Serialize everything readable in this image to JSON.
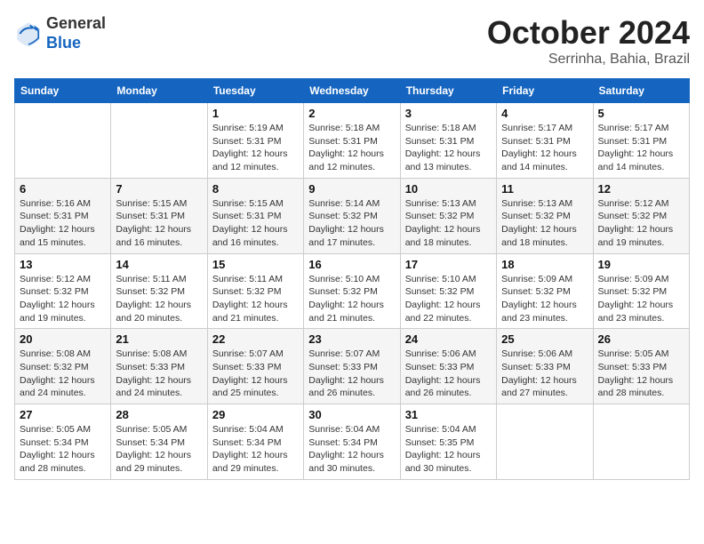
{
  "header": {
    "logo_line1": "General",
    "logo_line2": "Blue",
    "month_year": "October 2024",
    "location": "Serrinha, Bahia, Brazil"
  },
  "weekdays": [
    "Sunday",
    "Monday",
    "Tuesday",
    "Wednesday",
    "Thursday",
    "Friday",
    "Saturday"
  ],
  "weeks": [
    [
      {
        "day": "",
        "sunrise": "",
        "sunset": "",
        "daylight": ""
      },
      {
        "day": "",
        "sunrise": "",
        "sunset": "",
        "daylight": ""
      },
      {
        "day": "1",
        "sunrise": "Sunrise: 5:19 AM",
        "sunset": "Sunset: 5:31 PM",
        "daylight": "Daylight: 12 hours and 12 minutes."
      },
      {
        "day": "2",
        "sunrise": "Sunrise: 5:18 AM",
        "sunset": "Sunset: 5:31 PM",
        "daylight": "Daylight: 12 hours and 12 minutes."
      },
      {
        "day": "3",
        "sunrise": "Sunrise: 5:18 AM",
        "sunset": "Sunset: 5:31 PM",
        "daylight": "Daylight: 12 hours and 13 minutes."
      },
      {
        "day": "4",
        "sunrise": "Sunrise: 5:17 AM",
        "sunset": "Sunset: 5:31 PM",
        "daylight": "Daylight: 12 hours and 14 minutes."
      },
      {
        "day": "5",
        "sunrise": "Sunrise: 5:17 AM",
        "sunset": "Sunset: 5:31 PM",
        "daylight": "Daylight: 12 hours and 14 minutes."
      }
    ],
    [
      {
        "day": "6",
        "sunrise": "Sunrise: 5:16 AM",
        "sunset": "Sunset: 5:31 PM",
        "daylight": "Daylight: 12 hours and 15 minutes."
      },
      {
        "day": "7",
        "sunrise": "Sunrise: 5:15 AM",
        "sunset": "Sunset: 5:31 PM",
        "daylight": "Daylight: 12 hours and 16 minutes."
      },
      {
        "day": "8",
        "sunrise": "Sunrise: 5:15 AM",
        "sunset": "Sunset: 5:31 PM",
        "daylight": "Daylight: 12 hours and 16 minutes."
      },
      {
        "day": "9",
        "sunrise": "Sunrise: 5:14 AM",
        "sunset": "Sunset: 5:32 PM",
        "daylight": "Daylight: 12 hours and 17 minutes."
      },
      {
        "day": "10",
        "sunrise": "Sunrise: 5:13 AM",
        "sunset": "Sunset: 5:32 PM",
        "daylight": "Daylight: 12 hours and 18 minutes."
      },
      {
        "day": "11",
        "sunrise": "Sunrise: 5:13 AM",
        "sunset": "Sunset: 5:32 PM",
        "daylight": "Daylight: 12 hours and 18 minutes."
      },
      {
        "day": "12",
        "sunrise": "Sunrise: 5:12 AM",
        "sunset": "Sunset: 5:32 PM",
        "daylight": "Daylight: 12 hours and 19 minutes."
      }
    ],
    [
      {
        "day": "13",
        "sunrise": "Sunrise: 5:12 AM",
        "sunset": "Sunset: 5:32 PM",
        "daylight": "Daylight: 12 hours and 19 minutes."
      },
      {
        "day": "14",
        "sunrise": "Sunrise: 5:11 AM",
        "sunset": "Sunset: 5:32 PM",
        "daylight": "Daylight: 12 hours and 20 minutes."
      },
      {
        "day": "15",
        "sunrise": "Sunrise: 5:11 AM",
        "sunset": "Sunset: 5:32 PM",
        "daylight": "Daylight: 12 hours and 21 minutes."
      },
      {
        "day": "16",
        "sunrise": "Sunrise: 5:10 AM",
        "sunset": "Sunset: 5:32 PM",
        "daylight": "Daylight: 12 hours and 21 minutes."
      },
      {
        "day": "17",
        "sunrise": "Sunrise: 5:10 AM",
        "sunset": "Sunset: 5:32 PM",
        "daylight": "Daylight: 12 hours and 22 minutes."
      },
      {
        "day": "18",
        "sunrise": "Sunrise: 5:09 AM",
        "sunset": "Sunset: 5:32 PM",
        "daylight": "Daylight: 12 hours and 23 minutes."
      },
      {
        "day": "19",
        "sunrise": "Sunrise: 5:09 AM",
        "sunset": "Sunset: 5:32 PM",
        "daylight": "Daylight: 12 hours and 23 minutes."
      }
    ],
    [
      {
        "day": "20",
        "sunrise": "Sunrise: 5:08 AM",
        "sunset": "Sunset: 5:32 PM",
        "daylight": "Daylight: 12 hours and 24 minutes."
      },
      {
        "day": "21",
        "sunrise": "Sunrise: 5:08 AM",
        "sunset": "Sunset: 5:33 PM",
        "daylight": "Daylight: 12 hours and 24 minutes."
      },
      {
        "day": "22",
        "sunrise": "Sunrise: 5:07 AM",
        "sunset": "Sunset: 5:33 PM",
        "daylight": "Daylight: 12 hours and 25 minutes."
      },
      {
        "day": "23",
        "sunrise": "Sunrise: 5:07 AM",
        "sunset": "Sunset: 5:33 PM",
        "daylight": "Daylight: 12 hours and 26 minutes."
      },
      {
        "day": "24",
        "sunrise": "Sunrise: 5:06 AM",
        "sunset": "Sunset: 5:33 PM",
        "daylight": "Daylight: 12 hours and 26 minutes."
      },
      {
        "day": "25",
        "sunrise": "Sunrise: 5:06 AM",
        "sunset": "Sunset: 5:33 PM",
        "daylight": "Daylight: 12 hours and 27 minutes."
      },
      {
        "day": "26",
        "sunrise": "Sunrise: 5:05 AM",
        "sunset": "Sunset: 5:33 PM",
        "daylight": "Daylight: 12 hours and 28 minutes."
      }
    ],
    [
      {
        "day": "27",
        "sunrise": "Sunrise: 5:05 AM",
        "sunset": "Sunset: 5:34 PM",
        "daylight": "Daylight: 12 hours and 28 minutes."
      },
      {
        "day": "28",
        "sunrise": "Sunrise: 5:05 AM",
        "sunset": "Sunset: 5:34 PM",
        "daylight": "Daylight: 12 hours and 29 minutes."
      },
      {
        "day": "29",
        "sunrise": "Sunrise: 5:04 AM",
        "sunset": "Sunset: 5:34 PM",
        "daylight": "Daylight: 12 hours and 29 minutes."
      },
      {
        "day": "30",
        "sunrise": "Sunrise: 5:04 AM",
        "sunset": "Sunset: 5:34 PM",
        "daylight": "Daylight: 12 hours and 30 minutes."
      },
      {
        "day": "31",
        "sunrise": "Sunrise: 5:04 AM",
        "sunset": "Sunset: 5:35 PM",
        "daylight": "Daylight: 12 hours and 30 minutes."
      },
      {
        "day": "",
        "sunrise": "",
        "sunset": "",
        "daylight": ""
      },
      {
        "day": "",
        "sunrise": "",
        "sunset": "",
        "daylight": ""
      }
    ]
  ]
}
